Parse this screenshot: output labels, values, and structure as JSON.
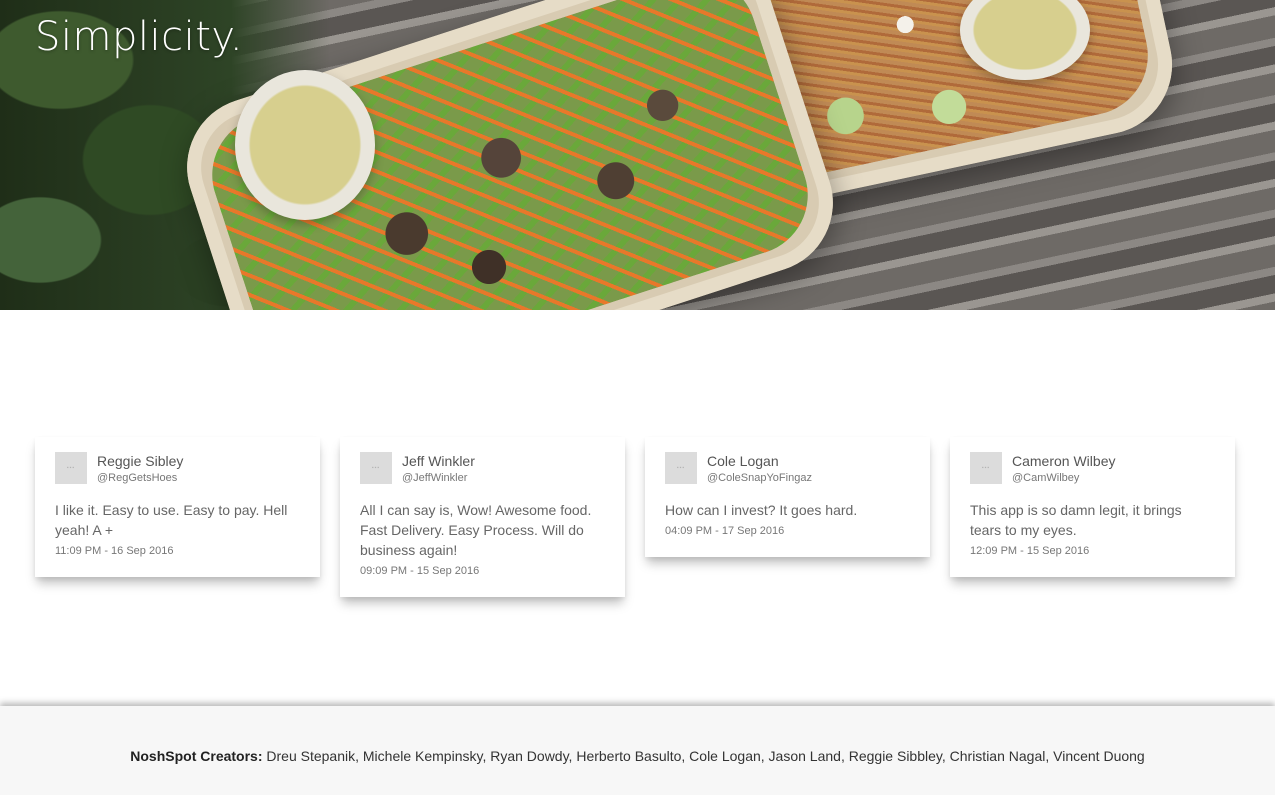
{
  "hero": {
    "title": "Simplicity."
  },
  "testimonials": [
    {
      "name": "Reggie Sibley",
      "handle": "@RegGetsHoes",
      "text": "I like it. Easy to use. Easy to pay. Hell yeah! A +",
      "time": "11:09 PM - 16 Sep 2016",
      "avatar_icon": "avatar-placeholder"
    },
    {
      "name": "Jeff Winkler",
      "handle": "@JeffWinkler",
      "text": "All I can say is, Wow! Awesome food. Fast Delivery. Easy Process. Will do business again!",
      "time": "09:09 PM - 15 Sep 2016",
      "avatar_icon": "avatar-placeholder"
    },
    {
      "name": "Cole Logan",
      "handle": "@ColeSnapYoFingaz",
      "text": "How can I invest? It goes hard.",
      "time": "04:09 PM - 17 Sep 2016",
      "avatar_icon": "avatar-placeholder"
    },
    {
      "name": "Cameron Wilbey",
      "handle": "@CamWilbey",
      "text": "This app is so damn legit, it brings tears to my eyes.",
      "time": "12:09 PM - 15 Sep 2016",
      "avatar_icon": "avatar-placeholder"
    }
  ],
  "footer": {
    "label": "NoshSpot Creators:",
    "names": "Dreu Stepanik, Michele Kempinsky, Ryan Dowdy, Herberto Basulto, Cole Logan, Jason Land, Reggie Sibbley, Christian Nagal, Vincent Duong"
  }
}
